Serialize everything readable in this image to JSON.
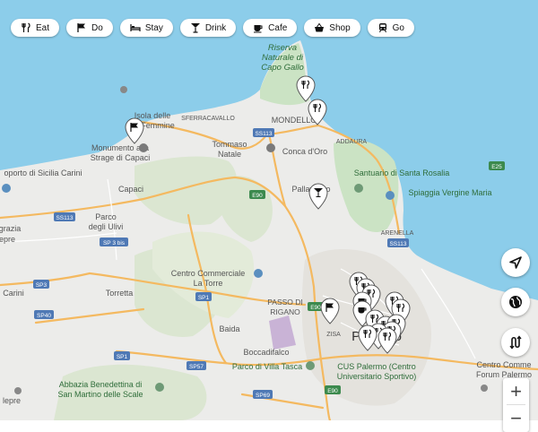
{
  "filters": [
    {
      "label": "Eat",
      "icon": "fork-knife-icon"
    },
    {
      "label": "Do",
      "icon": "flag-icon"
    },
    {
      "label": "Stay",
      "icon": "bed-icon"
    },
    {
      "label": "Drink",
      "icon": "cocktail-icon"
    },
    {
      "label": "Cafe",
      "icon": "coffee-cup-icon"
    },
    {
      "label": "Shop",
      "icon": "shopping-basket-icon"
    },
    {
      "label": "Go",
      "icon": "train-icon"
    }
  ],
  "controls": {
    "locate": "navigation-arrow-icon",
    "globe": "globe-icon",
    "route": "route-icon",
    "zoom_in": "+",
    "zoom_out": "−"
  },
  "map_labels": {
    "riserva": "Riserva",
    "naturale": "Naturale di",
    "capo_gallo": "Capo Gallo",
    "mondello": "MONDELLO",
    "sferracavallo": "SFERRACAVALLO",
    "isola_delle": "Isola delle",
    "femmine": "Femmine",
    "monumento": "Monumento alla",
    "strage": "Strage di Capaci",
    "tommaso": "Tommaso",
    "natale": "Natale",
    "ss113_top": "SS113",
    "addaura": "ADDAURA",
    "conca": "Conca d'Oro",
    "santuario": "Santuario di Santa Rosalia",
    "e25": "E25",
    "aeroporto": "oporto di Sicilia Carini",
    "capaci": "Capaci",
    "e90_mid": "E90",
    "pallavicino": "Pallavicino",
    "spiaggia": "Spiaggia Vergine Maria",
    "ss113_left": "SS113",
    "grazia": "grazia",
    "parco": "Parco",
    "degli_ulivi": "degli Ulivi",
    "epre": "epre",
    "sp3bis": "SP 3 bis",
    "arenella": "ARENELLA",
    "ss113_right": "SS113",
    "centro_comm": "Centro Commerciale",
    "la_torre": "La Torre",
    "sp3": "SP3",
    "carini": "Carini",
    "torretta": "Torretta",
    "sp1_mid": "SP1",
    "passo": "PASSO DI",
    "rigano": "RIGANO",
    "e90_city": "E90",
    "sp40": "SP40",
    "zisa": "ZISA",
    "palermo": "Palermo",
    "baida": "Baida",
    "boccadifalco": "Boccadifalco",
    "sp1_low": "SP1",
    "parco_tasca": "Parco di Villa Tasca",
    "sp57": "SP57",
    "cus": "CUS Palermo (Centro",
    "cus2": "Universitario Sportivo)",
    "centro_right": "Centro Comme",
    "forum": "Forum Palermo",
    "abbazia": "Abbazia Benedettina di",
    "san_martino": "San Martino delle Scale",
    "sp69": "SP69",
    "e90_bottom": "E90",
    "lepre": "lepre"
  }
}
